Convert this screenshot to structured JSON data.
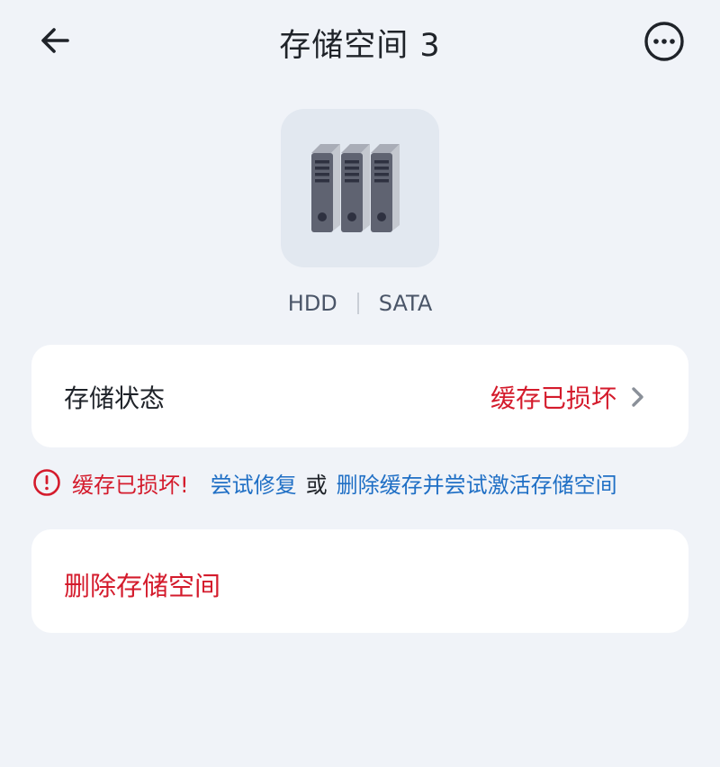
{
  "header": {
    "title": "存储空间 3",
    "back_icon": "arrow-left-icon",
    "more_icon": "more-horizontal-circle-icon"
  },
  "device": {
    "icon": "hdd-rack-icon",
    "type": "HDD",
    "interface": "SATA"
  },
  "status": {
    "label": "存储状态",
    "value": "缓存已损坏",
    "value_color": "#d41b2c"
  },
  "warning": {
    "icon": "alert-circle-icon",
    "text": "缓存已损坏!",
    "repair_link": "尝试修复",
    "or": "或",
    "delete_cache_link": "删除缓存并尝试激活存储空间",
    "link_color": "#1f6fc5"
  },
  "actions": {
    "delete_label": "删除存储空间"
  }
}
